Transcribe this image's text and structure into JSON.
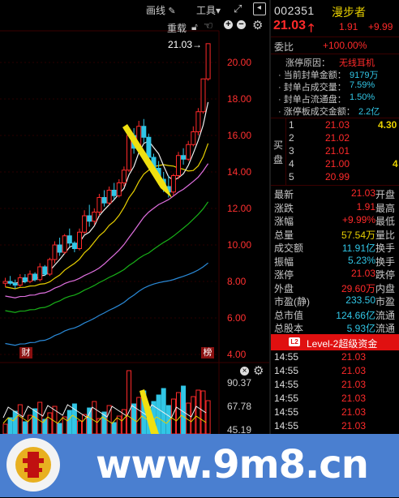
{
  "toolbar": {
    "draw_label": "画线",
    "tools_label": "工具",
    "tools_caret": "▾",
    "reload_label": "重载"
  },
  "price_axis": [
    "20.00",
    "18.00",
    "16.00",
    "14.00",
    "12.00",
    "10.00",
    "8.00",
    "6.00",
    "4.00"
  ],
  "last_price_label": "21.03→",
  "event_markers": {
    "cai": "财",
    "bang": "榜"
  },
  "volume_axis": [
    "90.37",
    "67.78",
    "45.19"
  ],
  "stock": {
    "code": "002351",
    "name": "漫步者",
    "price": "21.03",
    "change": "1.91",
    "change_pct": "+9.99"
  },
  "weibi": {
    "label": "委比",
    "value": "+100.00%"
  },
  "limit_up_info": [
    {
      "label": "涨停原因：",
      "value": "无线耳机",
      "color": "#ff2a2a"
    },
    {
      "label": "· 当前封单金额：",
      "value": "9179万",
      "color": "#31c6e6"
    },
    {
      "label": "· 封单占成交量：",
      "value": "7.59%",
      "color": "#31c6e6"
    },
    {
      "label": "· 封单占流通盘：",
      "value": "1.50%",
      "color": "#31c6e6"
    },
    {
      "label": "· 涨停板成交金额：",
      "value": "2.2亿",
      "color": "#31c6e6"
    }
  ],
  "buy_side_label": [
    "买",
    "盘"
  ],
  "order_book": [
    {
      "level": "1",
      "price": "21.03",
      "volume": "4.30"
    },
    {
      "level": "2",
      "price": "21.02",
      "volume": ""
    },
    {
      "level": "3",
      "price": "21.01",
      "volume": ""
    },
    {
      "level": "4",
      "price": "21.00",
      "volume": "4"
    },
    {
      "level": "5",
      "price": "20.99",
      "volume": ""
    }
  ],
  "stats": [
    {
      "label": "最新",
      "value": "21.03",
      "color": "#ff2a2a",
      "label2": "开盘"
    },
    {
      "label": "涨跌",
      "value": "1.91",
      "color": "#ff2a2a",
      "label2": "最高"
    },
    {
      "label": "涨幅",
      "value": "+9.99%",
      "color": "#ff2a2a",
      "label2": "最低"
    },
    {
      "label": "总量",
      "value": "57.54万",
      "color": "#e8d000",
      "label2": "量比"
    },
    {
      "label": "成交额",
      "value": "11.91亿",
      "color": "#31c6e6",
      "label2": "换手"
    },
    {
      "label": "振幅",
      "value": "5.23%",
      "color": "#31c6e6",
      "label2": "换手"
    },
    {
      "label": "涨停",
      "value": "21.03",
      "color": "#ff2a2a",
      "label2": "跌停"
    },
    {
      "label": "外盘",
      "value": "29.60万",
      "color": "#ff2a2a",
      "label2": "内盘"
    },
    {
      "label": "市盈(静)",
      "value": "233.50",
      "color": "#31c6e6",
      "label2": "市盈"
    },
    {
      "label": "总市值",
      "value": "124.66亿",
      "color": "#31c6e6",
      "label2": "流通"
    },
    {
      "label": "总股本",
      "value": "5.93亿",
      "color": "#31c6e6",
      "label2": "流通"
    }
  ],
  "level2": {
    "badge": "L2",
    "label": "Level-2超级资金"
  },
  "ticks": [
    {
      "time": "14:55",
      "price": "21.03"
    },
    {
      "time": "14:55",
      "price": "21.03"
    },
    {
      "time": "14:55",
      "price": "21.03"
    },
    {
      "time": "14:55",
      "price": "21.03"
    },
    {
      "time": "14:55",
      "price": "21.03"
    },
    {
      "time": "14:55",
      "price": "21.03"
    },
    {
      "time": "14:55",
      "price": "21.03"
    }
  ],
  "watermark": {
    "url": "www.9m8.cn",
    "logo_ring": "www.9m8.cn"
  },
  "chart_data": {
    "type": "candlestick",
    "ylim": [
      4,
      21.5
    ],
    "candles": [
      [
        7.9,
        8.2,
        7.7,
        8.0
      ],
      [
        8.0,
        8.3,
        7.8,
        7.9
      ],
      [
        7.9,
        8.1,
        7.6,
        7.8
      ],
      [
        7.8,
        8.4,
        7.7,
        8.2
      ],
      [
        8.2,
        8.4,
        7.9,
        8.0
      ],
      [
        8.0,
        8.6,
        7.9,
        8.4
      ],
      [
        8.4,
        8.5,
        8.0,
        8.1
      ],
      [
        8.1,
        9.0,
        8.0,
        8.8
      ],
      [
        8.8,
        8.9,
        8.3,
        8.4
      ],
      [
        8.4,
        9.3,
        8.3,
        9.2
      ],
      [
        9.2,
        10.2,
        9.0,
        10.0
      ],
      [
        10.0,
        10.4,
        9.4,
        9.6
      ],
      [
        9.6,
        10.6,
        9.5,
        10.5
      ],
      [
        10.5,
        10.9,
        9.9,
        10.1
      ],
      [
        10.1,
        10.2,
        9.6,
        9.8
      ],
      [
        9.8,
        10.9,
        9.7,
        10.7
      ],
      [
        10.7,
        11.9,
        10.6,
        11.6
      ],
      [
        11.6,
        12.2,
        11.0,
        11.3
      ],
      [
        11.3,
        12.0,
        11.1,
        11.8
      ],
      [
        11.8,
        12.8,
        11.6,
        12.6
      ],
      [
        12.6,
        13.0,
        12.1,
        12.3
      ],
      [
        12.3,
        13.2,
        12.2,
        13.0
      ],
      [
        13.0,
        13.4,
        12.5,
        12.7
      ],
      [
        12.7,
        13.6,
        12.6,
        13.4
      ],
      [
        13.4,
        14.3,
        13.2,
        14.1
      ],
      [
        14.1,
        16.3,
        14.0,
        16.0
      ],
      [
        16.0,
        16.4,
        15.0,
        15.3
      ],
      [
        15.3,
        16.8,
        15.1,
        16.5
      ],
      [
        16.5,
        16.9,
        15.6,
        15.9
      ],
      [
        15.9,
        16.1,
        14.5,
        14.8
      ],
      [
        14.8,
        15.0,
        14.0,
        14.2
      ],
      [
        14.2,
        14.6,
        13.3,
        13.6
      ],
      [
        13.6,
        14.0,
        12.9,
        13.2
      ],
      [
        13.2,
        13.8,
        12.6,
        12.9
      ],
      [
        12.9,
        13.9,
        12.7,
        13.8
      ],
      [
        13.8,
        15.1,
        13.6,
        14.9
      ],
      [
        14.9,
        15.3,
        14.4,
        14.7
      ],
      [
        14.7,
        15.7,
        14.6,
        15.5
      ],
      [
        15.5,
        16.5,
        15.4,
        16.2
      ],
      [
        16.2,
        17.5,
        16.0,
        17.3
      ],
      [
        17.3,
        19.1,
        17.2,
        19.1
      ],
      [
        19.1,
        21.03,
        19.0,
        21.03
      ]
    ]
  }
}
